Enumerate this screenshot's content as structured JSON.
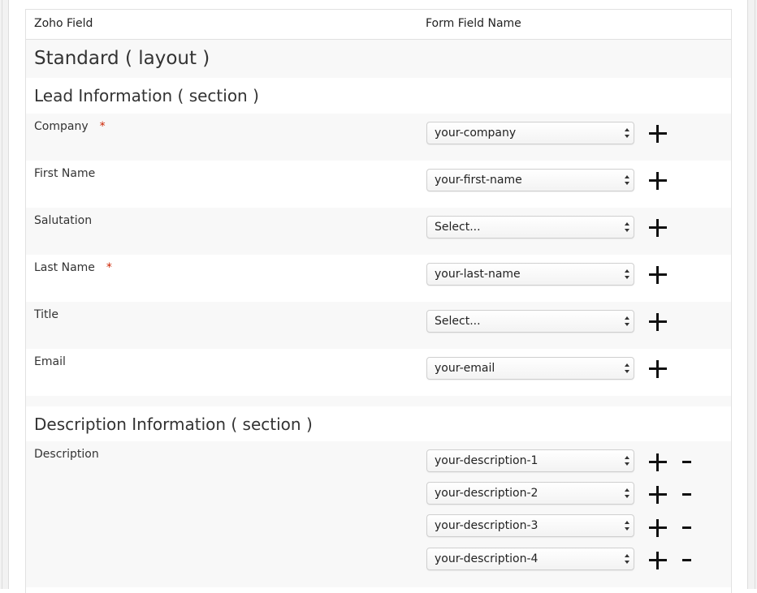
{
  "header": {
    "col_zoho_field": "Zoho Field",
    "col_form_field_name": "Form Field Name"
  },
  "layout_title": "Standard ( layout )",
  "sections": [
    {
      "title": "Lead Information ( section )",
      "fields": [
        {
          "label": "Company",
          "required": true,
          "required_mark": "*",
          "selects": [
            "your-company"
          ]
        },
        {
          "label": "First Name",
          "required": false,
          "selects": [
            "your-first-name"
          ]
        },
        {
          "label": "Salutation",
          "required": false,
          "selects": [
            "Select..."
          ]
        },
        {
          "label": "Last Name",
          "required": true,
          "required_mark": "*",
          "selects": [
            "your-last-name"
          ]
        },
        {
          "label": "Title",
          "required": false,
          "selects": [
            "Select..."
          ]
        },
        {
          "label": "Email",
          "required": false,
          "selects": [
            "your-email"
          ]
        }
      ]
    },
    {
      "title": "Description Information ( section )",
      "fields": [
        {
          "label": "Description",
          "required": false,
          "selects": [
            "your-description-1",
            "your-description-2",
            "your-description-3",
            "your-description-4"
          ]
        }
      ]
    }
  ],
  "icons": {
    "add": "plus-icon",
    "remove": "minus-icon"
  },
  "colors": {
    "required_asterisk": "#cc2200",
    "band_grey": "#f8f8f8",
    "border": "#e1e1e1"
  }
}
